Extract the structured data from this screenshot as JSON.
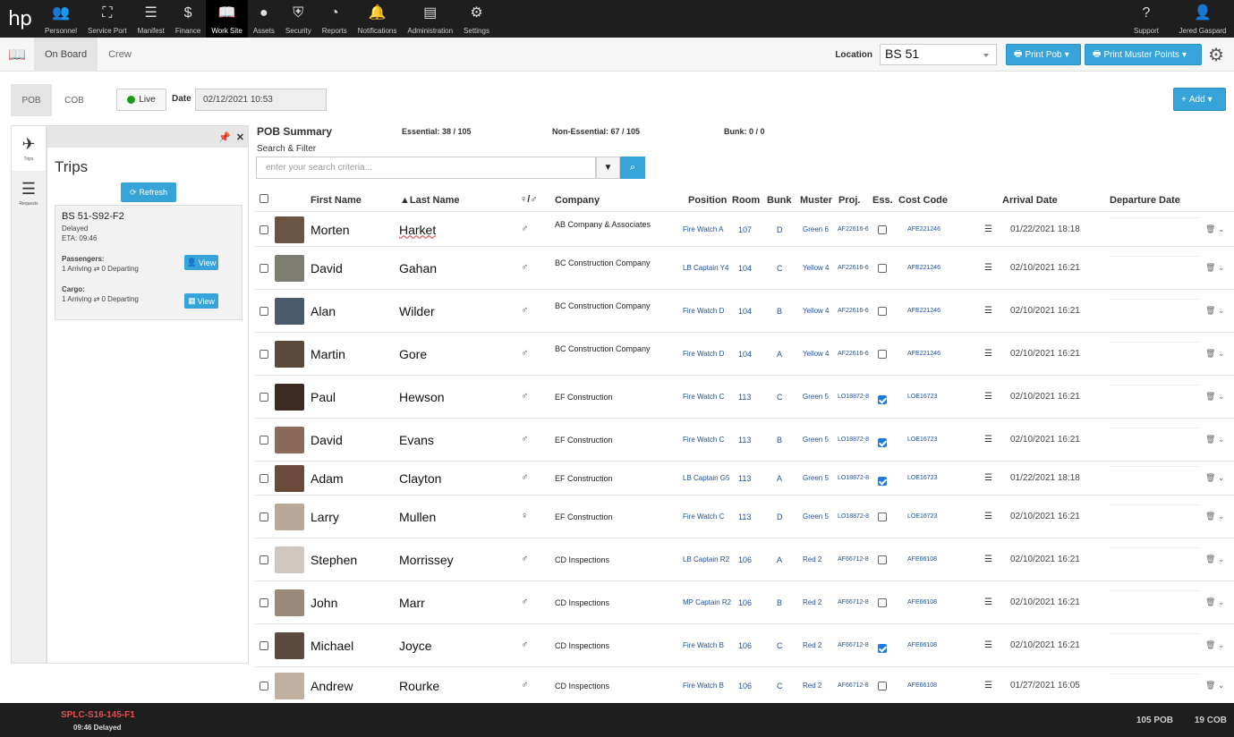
{
  "nav": {
    "logo": "hp",
    "items": [
      {
        "label": "Personnel",
        "icon": "users-icon",
        "glyph": "👥"
      },
      {
        "label": "Service Port",
        "icon": "sitemap-icon",
        "glyph": "⛶"
      },
      {
        "label": "Manifest",
        "icon": "list-icon",
        "glyph": "☰"
      },
      {
        "label": "Finance",
        "icon": "dollar-icon",
        "glyph": "$"
      },
      {
        "label": "Work Site",
        "icon": "book-icon",
        "glyph": "📖"
      },
      {
        "label": "Assets",
        "icon": "globe-icon",
        "glyph": "●"
      },
      {
        "label": "Security",
        "icon": "shield-icon",
        "glyph": "⛨"
      },
      {
        "label": "Reports",
        "icon": "dashboard-icon",
        "glyph": "◔"
      },
      {
        "label": "Notifications",
        "icon": "bell-icon",
        "glyph": "🔔"
      },
      {
        "label": "Administration",
        "icon": "server-icon",
        "glyph": "▤"
      },
      {
        "label": "Settings",
        "icon": "cogs-icon",
        "glyph": "⚙"
      }
    ],
    "active": "Work Site",
    "support": "Support",
    "user": "Jered Gaspard"
  },
  "subbar": {
    "tabs": [
      "On Board",
      "Crew"
    ],
    "location_label": "Location",
    "location_value": "BS 51",
    "print_pob": "Print Pob",
    "print_muster": "Print Muster Points"
  },
  "controls": {
    "pob": "POB",
    "cob": "COB",
    "live": "Live",
    "date_label": "Date",
    "date_value": "02/12/2021 10:53",
    "add": "Add"
  },
  "sidebar": {
    "trips": "Trips",
    "requests": "Requests"
  },
  "trips": {
    "title": "Trips",
    "refresh": "Refresh",
    "card": {
      "name": "BS 51-S92-F2",
      "status": "Delayed",
      "eta": "ETA: 09:46",
      "passengers_label": "Passengers:",
      "passengers": "1 Arriving ⇄ 0 Departing",
      "cargo_label": "Cargo:",
      "cargo": "1 Arriving ⇄ 0 Departing",
      "view": "View"
    }
  },
  "summary": {
    "title": "POB Summary",
    "essential": "Essential: 38 / 105",
    "non_essential": "Non-Essential: 67 / 105",
    "bunk": "Bunk: 0 / 0"
  },
  "search": {
    "label": "Search & Filter",
    "placeholder": "enter your search criteria..."
  },
  "columns": {
    "first": "First Name",
    "last": "▲Last Name",
    "gender": "♀/♂",
    "company": "Company",
    "position": "Position",
    "room": "Room",
    "bunk": "Bunk",
    "muster": "Muster",
    "proj": "Proj.",
    "ess": "Ess.",
    "cost": "Cost Code",
    "arrival": "Arrival Date",
    "departure": "Departure Date"
  },
  "rows": [
    {
      "first": "Morten",
      "last": "Harket",
      "gender": "♂",
      "company": "AB Company & Associates",
      "position": "Fire Watch A",
      "room": "107",
      "bunk": "D",
      "muster": "Green 6",
      "proj": "AF22616-6",
      "ess": false,
      "cost": "AFE221246",
      "arrival": "01/22/2021 18:18",
      "avatar": "#6b5443"
    },
    {
      "first": "David",
      "last": "Gahan",
      "gender": "♂",
      "company": "BC Construction Company",
      "position": "LB Captain Y4",
      "room": "104",
      "bunk": "C",
      "muster": "Yellow 4",
      "proj": "AF22616-6",
      "ess": false,
      "cost": "AFE221246",
      "arrival": "02/10/2021 16:21",
      "avatar": "#7d7d72"
    },
    {
      "first": "Alan",
      "last": "Wilder",
      "gender": "♂",
      "company": "BC Construction Company",
      "position": "Fire Watch D",
      "room": "104",
      "bunk": "B",
      "muster": "Yellow 4",
      "proj": "AF22616-6",
      "ess": false,
      "cost": "AFE221246",
      "arrival": "02/10/2021 16:21",
      "avatar": "#4a5a6a"
    },
    {
      "first": "Martin",
      "last": "Gore",
      "gender": "♂",
      "company": "BC Construction Company",
      "position": "Fire Watch D",
      "room": "104",
      "bunk": "A",
      "muster": "Yellow 4",
      "proj": "AF22616-6",
      "ess": false,
      "cost": "AFE221246",
      "arrival": "02/10/2021 16:21",
      "avatar": "#5a4a3c"
    },
    {
      "first": "Paul",
      "last": "Hewson",
      "gender": "♂",
      "company": "EF Construction",
      "position": "Fire Watch C",
      "room": "113",
      "bunk": "C",
      "muster": "Green 5",
      "proj": "LO18872-8",
      "ess": true,
      "cost": "LOE16723",
      "arrival": "02/10/2021 16:21",
      "avatar": "#3a2a22"
    },
    {
      "first": "David",
      "last": "Evans",
      "gender": "♂",
      "company": "EF Construction",
      "position": "Fire Watch C",
      "room": "113",
      "bunk": "B",
      "muster": "Green 5",
      "proj": "LO18872-8",
      "ess": true,
      "cost": "LOE16723",
      "arrival": "02/10/2021 16:21",
      "avatar": "#8a6a58"
    },
    {
      "first": "Adam",
      "last": "Clayton",
      "gender": "♂",
      "company": "EF Construction",
      "position": "LB Captain G5",
      "room": "113",
      "bunk": "A",
      "muster": "Green 5",
      "proj": "LO18872-8",
      "ess": true,
      "cost": "LOE16723",
      "arrival": "01/22/2021 18:18",
      "avatar": "#6a4a3a"
    },
    {
      "first": "Larry",
      "last": "Mullen",
      "gender": "♀",
      "company": "EF Construction",
      "position": "Fire Watch C",
      "room": "113",
      "bunk": "D",
      "muster": "Green 5",
      "proj": "LO18872-8",
      "ess": false,
      "cost": "LOE16723",
      "arrival": "02/10/2021 16:21",
      "avatar": "#b8a898"
    },
    {
      "first": "Stephen",
      "last": "Morrissey",
      "gender": "♂",
      "company": "CD Inspections",
      "position": "LB Captain R2",
      "room": "106",
      "bunk": "A",
      "muster": "Red 2",
      "proj": "AF66712-8",
      "ess": false,
      "cost": "AFE66108",
      "arrival": "02/10/2021 16:21",
      "avatar": "#d0c8c0"
    },
    {
      "first": "John",
      "last": "Marr",
      "gender": "♂",
      "company": "CD Inspections",
      "position": "MP Captain R2",
      "room": "106",
      "bunk": "B",
      "muster": "Red 2",
      "proj": "AF66712-8",
      "ess": false,
      "cost": "AFE66108",
      "arrival": "02/10/2021 16:21",
      "avatar": "#9a8a7a"
    },
    {
      "first": "Michael",
      "last": "Joyce",
      "gender": "♂",
      "company": "CD Inspections",
      "position": "Fire Watch B",
      "room": "106",
      "bunk": "C",
      "muster": "Red 2",
      "proj": "AF66712-8",
      "ess": true,
      "cost": "AFE66108",
      "arrival": "02/10/2021 16:21",
      "avatar": "#5a4a40"
    },
    {
      "first": "Andrew",
      "last": "Rourke",
      "gender": "♂",
      "company": "CD Inspections",
      "position": "Fire Watch B",
      "room": "106",
      "bunk": "C",
      "muster": "Red 2",
      "proj": "AF66712-8",
      "ess": false,
      "cost": "AFE66108",
      "arrival": "01/27/2021 16:05",
      "avatar": "#c0b0a0"
    }
  ],
  "footer": {
    "trip": "SPLC-S16-145-F1",
    "status": "09:46 Delayed",
    "pob": "105 POB",
    "cob": "19 COB"
  }
}
